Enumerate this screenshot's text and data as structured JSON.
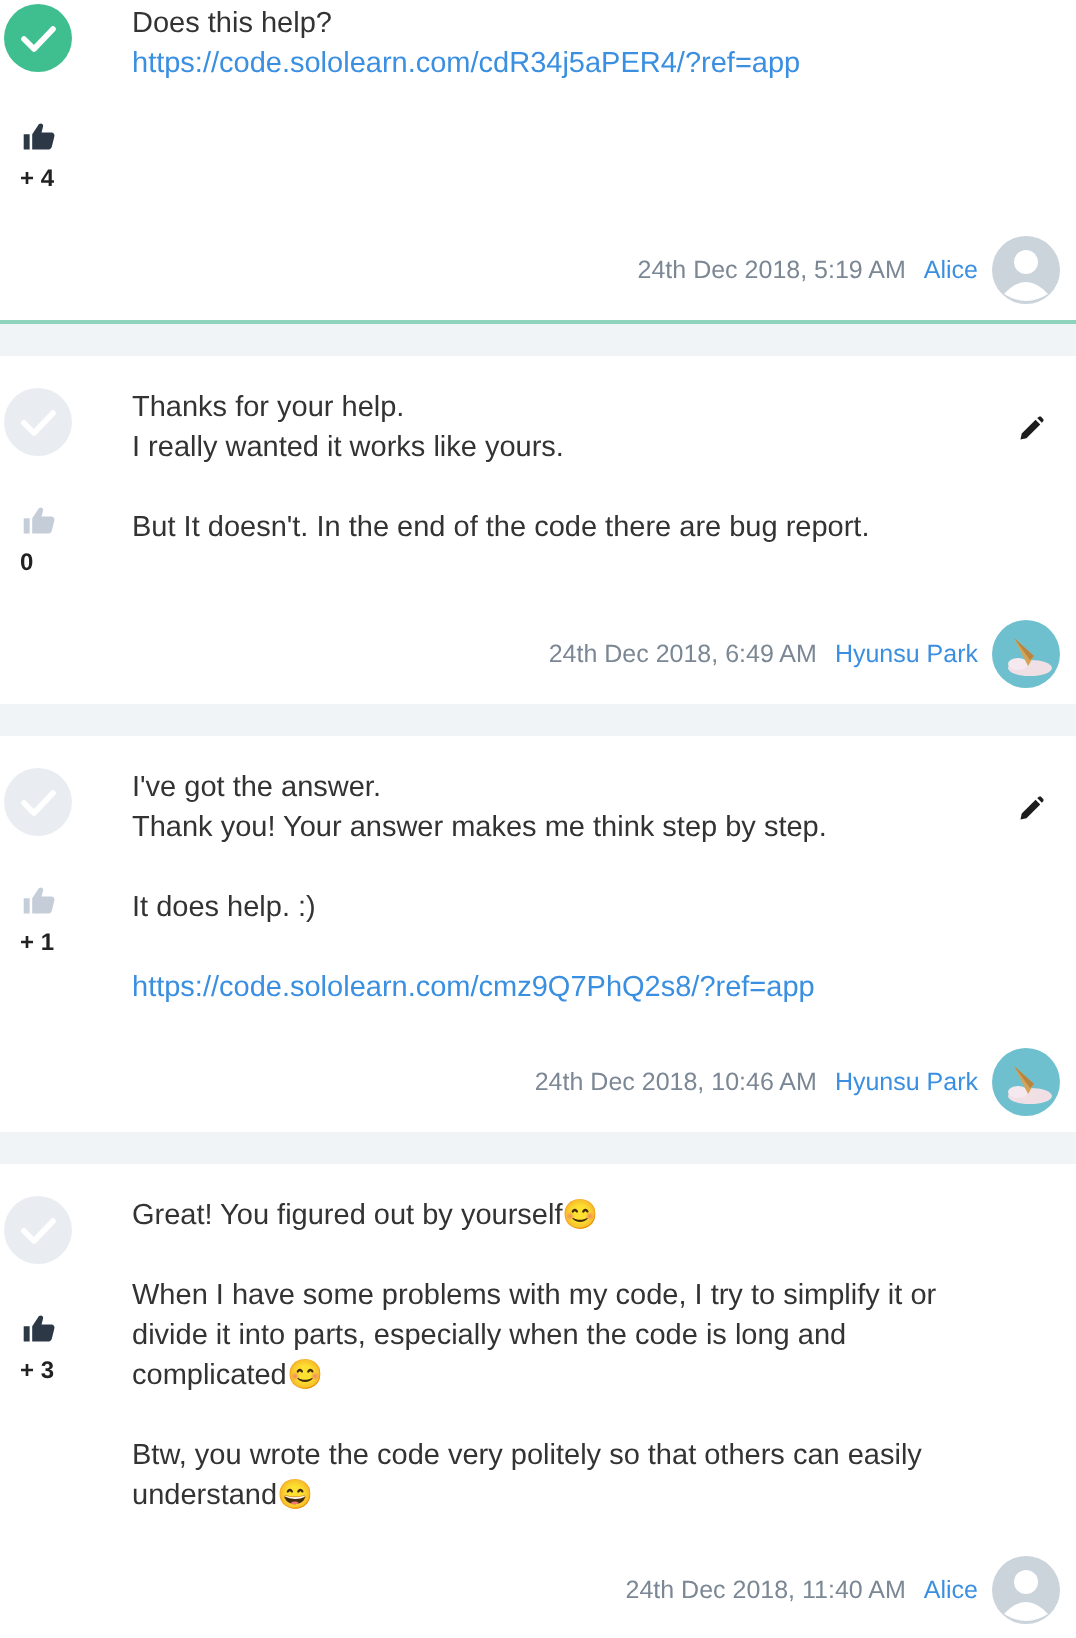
{
  "posts": [
    {
      "accepted": true,
      "liked": true,
      "votes": "+ 4",
      "editable": false,
      "blocks": [
        {
          "kind": "text",
          "text": "Does this help?"
        },
        {
          "kind": "link",
          "text": "https://code.sololearn.com/cdR34j5aPER4/?ref=app"
        }
      ],
      "date": "24th Dec 2018, 5:19 AM",
      "author": "Alice",
      "avatar": {
        "kind": "default"
      },
      "highlight": true
    },
    {
      "accepted": false,
      "liked": false,
      "votes": "0",
      "editable": true,
      "blocks": [
        {
          "kind": "text",
          "text": "Thanks for your help.\nI really wanted it works like yours."
        },
        {
          "kind": "gap"
        },
        {
          "kind": "text",
          "text": "But It doesn't. In the end of the code there are bug report."
        }
      ],
      "date": "24th Dec 2018, 6:49 AM",
      "author": "Hyunsu Park",
      "avatar": {
        "kind": "picture"
      },
      "highlight": false
    },
    {
      "accepted": false,
      "liked": false,
      "votes": "+ 1",
      "editable": true,
      "blocks": [
        {
          "kind": "text",
          "text": "I've got the answer.\nThank you! Your answer makes me think step by step."
        },
        {
          "kind": "gap"
        },
        {
          "kind": "text",
          "text": "It does help. :)"
        },
        {
          "kind": "gap"
        },
        {
          "kind": "link",
          "text": "https://code.sololearn.com/cmz9Q7PhQ2s8/?ref=app"
        }
      ],
      "date": "24th Dec 2018, 10:46 AM",
      "author": "Hyunsu Park",
      "avatar": {
        "kind": "picture"
      },
      "highlight": false
    },
    {
      "accepted": false,
      "liked": true,
      "votes": "+ 3",
      "editable": false,
      "blocks": [
        {
          "kind": "text",
          "text": "Great! You figured out by yourself😊"
        },
        {
          "kind": "gap"
        },
        {
          "kind": "text",
          "text": "When I have some problems with my code, I try to simplify it or divide it into parts, especially when the code is long and complicated😊"
        },
        {
          "kind": "gap"
        },
        {
          "kind": "text",
          "text": "Btw, you wrote the code very politely so that others can easily understand😄"
        }
      ],
      "date": "24th Dec 2018, 11:40 AM",
      "author": "Alice",
      "avatar": {
        "kind": "default"
      },
      "highlight": false
    }
  ]
}
